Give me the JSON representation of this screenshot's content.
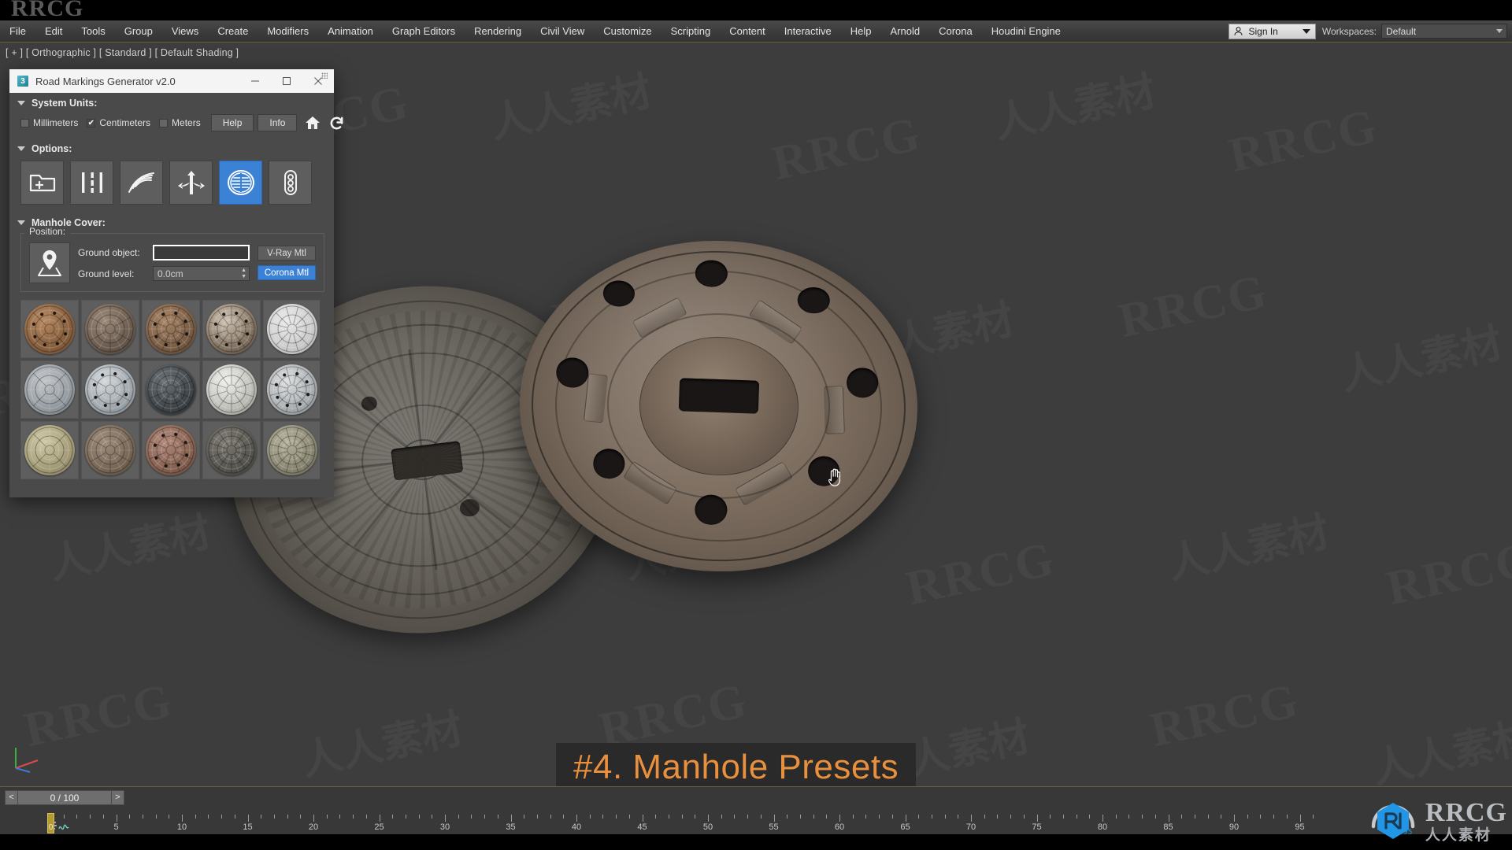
{
  "app": {
    "brand_watermark": "RRCG",
    "viewport_label": "[ + ] [ Orthographic ] [ Standard ] [ Default Shading ]"
  },
  "menubar": {
    "items": [
      "File",
      "Edit",
      "Tools",
      "Group",
      "Views",
      "Create",
      "Modifiers",
      "Animation",
      "Graph Editors",
      "Rendering",
      "Civil View",
      "Customize",
      "Scripting",
      "Content",
      "Interactive",
      "Help",
      "Arnold",
      "Corona",
      "Houdini Engine"
    ],
    "sign_in_label": "Sign In",
    "workspaces_label": "Workspaces:",
    "workspace_value": "Default"
  },
  "dialog": {
    "title": "Road Markings Generator v2.0",
    "icon_glyph": "3",
    "window_buttons": {
      "minimize": "–",
      "maximize": "□",
      "close": "✕"
    },
    "system_units": {
      "header": "System Units:",
      "options": [
        {
          "label": "Millimeters",
          "checked": false
        },
        {
          "label": "Centimeters",
          "checked": true
        },
        {
          "label": "Meters",
          "checked": false
        }
      ],
      "help_label": "Help",
      "info_label": "Info",
      "home_icon": "home-icon",
      "refresh_icon": "refresh-icon"
    },
    "options": {
      "header": "Options:",
      "tools": [
        {
          "name": "new-folder-icon",
          "active": false
        },
        {
          "name": "lane-lines-icon",
          "active": false
        },
        {
          "name": "curved-lines-icon",
          "active": false
        },
        {
          "name": "arrows-icon",
          "active": false
        },
        {
          "name": "manhole-icon",
          "active": true
        },
        {
          "name": "traffic-light-icon",
          "active": false
        }
      ]
    },
    "manhole": {
      "header": "Manhole Cover:",
      "position_group": "Position:",
      "ground_object_label": "Ground object:",
      "ground_object_value": "",
      "ground_level_label": "Ground level:",
      "ground_level_value": "0.0cm",
      "vray_label": "V-Ray Mtl",
      "corona_label": "Corona Mtl",
      "corona_active": true,
      "presets": [
        {
          "id": "preset-1",
          "colors": [
            "#b78a63",
            "#8a6240",
            "#6d4b30"
          ]
        },
        {
          "id": "preset-2",
          "colors": [
            "#9c8a7a",
            "#6e5f52",
            "#463c33"
          ]
        },
        {
          "id": "preset-3",
          "colors": [
            "#a78566",
            "#7d6048",
            "#553f2e"
          ]
        },
        {
          "id": "preset-4",
          "colors": [
            "#cfc3b4",
            "#8a7a69",
            "#4a3f35"
          ]
        },
        {
          "id": "preset-5",
          "colors": [
            "#e9e9e9",
            "#cfcfcf",
            "#a8a8a8"
          ]
        },
        {
          "id": "preset-6",
          "colors": [
            "#c3c6c9",
            "#9aa0a5",
            "#6e757b"
          ]
        },
        {
          "id": "preset-7",
          "colors": [
            "#d4d8db",
            "#a4abb0",
            "#787f85"
          ]
        },
        {
          "id": "preset-8",
          "colors": [
            "#6d7276",
            "#43484c",
            "#24282b"
          ]
        },
        {
          "id": "preset-9",
          "colors": [
            "#f0f0ee",
            "#c2c2bd",
            "#8e8e88"
          ]
        },
        {
          "id": "preset-10",
          "colors": [
            "#dcdedf",
            "#aeb2b5",
            "#7e8488"
          ]
        },
        {
          "id": "preset-11",
          "colors": [
            "#cfc9a8",
            "#a8a07c",
            "#7b7458"
          ]
        },
        {
          "id": "preset-12",
          "colors": [
            "#a08e7c",
            "#7b6b5a",
            "#534639"
          ]
        },
        {
          "id": "preset-13",
          "colors": [
            "#b0897a",
            "#8a6555",
            "#5d4238"
          ]
        },
        {
          "id": "preset-14",
          "colors": [
            "#7e7b74",
            "#5a5852",
            "#393733"
          ]
        },
        {
          "id": "preset-15",
          "colors": [
            "#b6b49d",
            "#8d8b76",
            "#615f4e"
          ]
        }
      ]
    }
  },
  "overlay": {
    "caption": "#4. Manhole Presets",
    "caption_color": "#e8903e",
    "caption_bg": "#2a2a2a"
  },
  "timeline": {
    "prev_label": "<",
    "next_label": ">",
    "frame_value": "0 / 100",
    "playhead_label": "0",
    "tick_labels": [
      "5",
      "10",
      "15",
      "20",
      "25",
      "30",
      "35",
      "40",
      "45",
      "50",
      "55",
      "60",
      "65",
      "70",
      "75",
      "80",
      "85",
      "90",
      "95"
    ]
  },
  "corner_logo": {
    "text": "RRCG",
    "subtext": "人人素材",
    "mark_color": "#2196e6"
  },
  "watermarks": {
    "latin": "RRCG",
    "cjk": "人人素材"
  }
}
